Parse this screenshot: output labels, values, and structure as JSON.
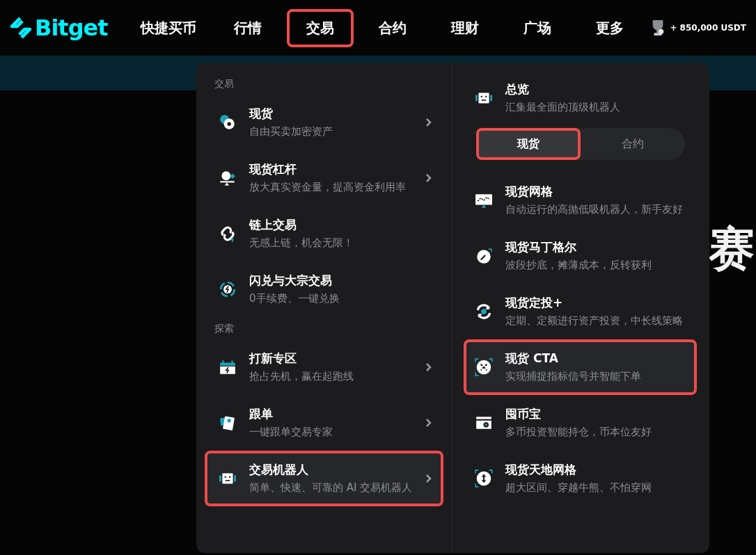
{
  "logo": {
    "text": "Bitget"
  },
  "nav": [
    {
      "label": "快捷买币",
      "highlighted": false
    },
    {
      "label": "行情",
      "highlighted": false
    },
    {
      "label": "交易",
      "highlighted": true
    },
    {
      "label": "合约",
      "highlighted": false
    },
    {
      "label": "理财",
      "highlighted": false
    },
    {
      "label": "广场",
      "highlighted": false
    },
    {
      "label": "更多",
      "highlighted": false
    }
  ],
  "reward": {
    "text": "+ 850,000 USDT"
  },
  "hero_text": "赛",
  "menu": {
    "sections": [
      {
        "heading": "交易",
        "items": [
          {
            "title": "现货",
            "subtitle": "自由买卖加密资产",
            "has_arrow": true,
            "selected": false,
            "highlighted": false
          },
          {
            "title": "现货杠杆",
            "subtitle": "放大真实资金量，提高资金利用率",
            "has_arrow": true,
            "selected": false,
            "highlighted": false
          },
          {
            "title": "链上交易",
            "subtitle": "无感上链，机会无限！",
            "has_arrow": false,
            "selected": false,
            "highlighted": false
          },
          {
            "title": "闪兑与大宗交易",
            "subtitle": "0手续费、一键兑换",
            "has_arrow": false,
            "selected": false,
            "highlighted": false
          }
        ]
      },
      {
        "heading": "探索",
        "items": [
          {
            "title": "打新专区",
            "subtitle": "抢占先机，赢在起跑线",
            "has_arrow": true,
            "selected": false,
            "highlighted": false
          },
          {
            "title": "跟单",
            "subtitle": "一键跟单交易专家",
            "has_arrow": true,
            "selected": false,
            "highlighted": false
          },
          {
            "title": "交易机器人",
            "subtitle": "简单、快速、可靠的 AI 交易机器人",
            "has_arrow": true,
            "selected": true,
            "highlighted": true
          }
        ]
      }
    ],
    "overview": {
      "title": "总览",
      "subtitle": "汇集最全面的顶级机器人"
    },
    "tabs": [
      {
        "label": "现货",
        "selected": true,
        "highlighted": true
      },
      {
        "label": "合约",
        "selected": false,
        "highlighted": false
      }
    ],
    "bots": [
      {
        "title": "现货网格",
        "subtitle": "自动运行的高抛低吸机器人，新手友好",
        "selected": false,
        "highlighted": false
      },
      {
        "title": "现货马丁格尔",
        "subtitle": "波段抄底，摊薄成本，反转获利",
        "selected": false,
        "highlighted": false
      },
      {
        "title": "现货定投+",
        "subtitle": "定期、定额进行资产投资，中长线策略",
        "selected": false,
        "highlighted": false
      },
      {
        "title": "现货 CTA",
        "subtitle": "实现捕捉指标信号并智能下单",
        "selected": true,
        "highlighted": true
      },
      {
        "title": "囤币宝",
        "subtitle": "多币投资智能持仓，币本位友好",
        "selected": false,
        "highlighted": false
      },
      {
        "title": "现货天地网格",
        "subtitle": "超大区间、穿越牛熊、不怕穿网",
        "selected": false,
        "highlighted": false
      }
    ]
  }
}
